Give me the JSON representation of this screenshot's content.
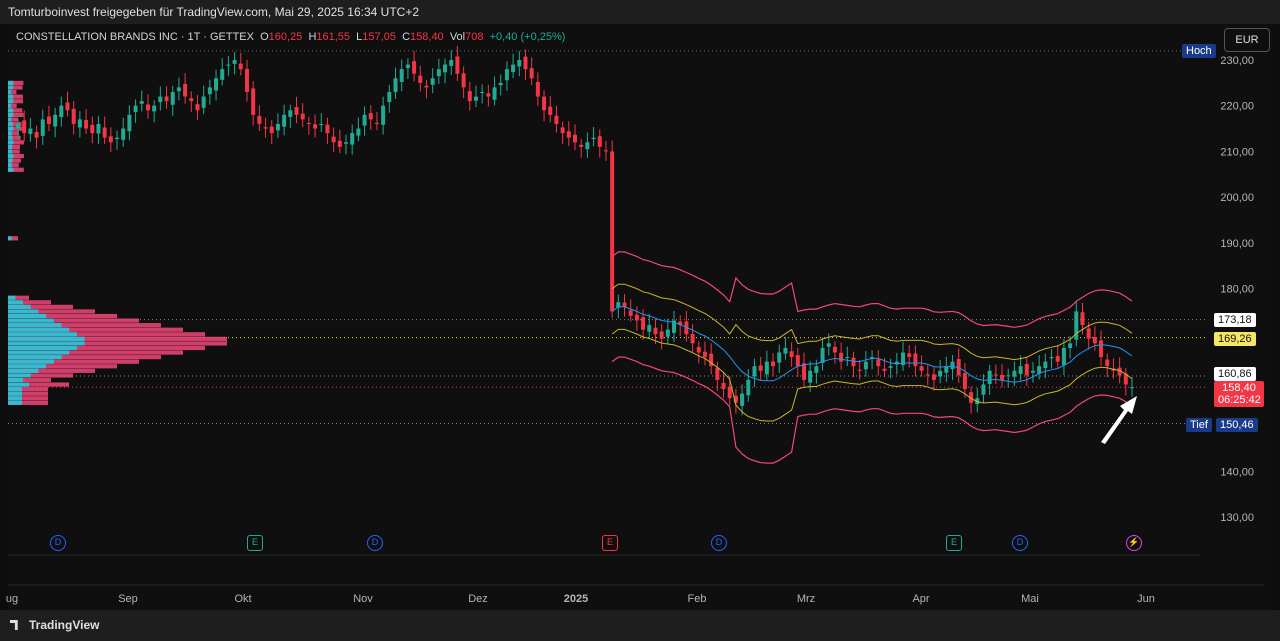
{
  "header": {
    "title": "Tomturboinvest freigegeben für TradingView.com, Mai 29, 2025 16:34 UTC+2"
  },
  "legend": {
    "symbol": "CONSTELLATION BRANDS INC · 1T · GETTEX",
    "o_label": "O",
    "o": "160,25",
    "h_label": "H",
    "h": "161,55",
    "l_label": "L",
    "l": "157,05",
    "c_label": "C",
    "c": "158,40",
    "vol_label": "Vol",
    "vol": "708",
    "change": "+0,40 (+0,25%)"
  },
  "currency_button": "EUR",
  "price_tags": {
    "hoch_label": "Hoch",
    "tief_label": "Tief",
    "tief_value": "150,46",
    "level_173": "173,18",
    "level_169": "169,26",
    "level_160": "160,86",
    "last_price": "158,40",
    "countdown": "06:25:42"
  },
  "events": [
    "D",
    "E",
    "D",
    "E",
    "D",
    "E",
    "D",
    "⚡"
  ],
  "footer": {
    "brand": "TradingView"
  },
  "colors": {
    "up": "#22ab94",
    "down": "#f23645",
    "band": "#f2467a",
    "inner_band": "#c9b62c",
    "mid_line": "#2196f3",
    "profile_cyan": "#26c6da",
    "profile_pink": "#f2467a"
  },
  "chart_data": {
    "type": "candlestick",
    "title": "",
    "x_ticks": [
      "ug",
      "Sep",
      "Okt",
      "Nov",
      "Dez",
      "2025",
      "Feb",
      "Mrz",
      "Apr",
      "Mai",
      "Jun"
    ],
    "y_ticks": [
      "230,00",
      "220,00",
      "210,00",
      "200,00",
      "190,00",
      "180,00",
      "170,00",
      "160,00",
      "150,00",
      "140,00",
      "130,00"
    ],
    "ylim": [
      124,
      233
    ],
    "horizontal_levels": [
      232.0,
      173.18,
      169.26,
      160.86,
      150.46
    ],
    "last": 158.4,
    "closes": [
      216,
      214,
      215,
      213,
      217,
      216,
      218,
      220,
      219,
      216,
      217,
      215,
      214,
      216,
      213,
      212,
      213,
      215,
      218,
      220,
      221,
      219,
      220,
      222,
      221,
      223,
      224,
      222,
      221,
      219,
      222,
      224,
      226,
      228,
      229,
      230,
      228,
      223,
      218,
      216,
      215,
      214,
      216,
      218,
      219,
      218,
      217,
      216,
      215,
      216,
      214,
      212,
      211,
      212,
      214,
      215,
      218,
      217,
      216,
      220,
      223,
      226,
      228,
      229,
      227,
      225,
      224,
      226,
      228,
      229,
      230,
      227,
      224,
      221,
      222,
      223,
      222,
      224,
      225,
      228,
      229,
      230,
      228,
      226,
      222,
      219,
      218,
      216,
      214,
      213,
      212,
      211,
      212,
      213,
      211,
      210,
      175,
      177,
      176,
      174,
      173,
      171,
      172,
      170,
      169,
      171,
      173,
      172,
      170,
      168,
      166,
      165,
      163,
      160,
      158,
      156,
      155,
      157,
      160,
      163,
      162,
      164,
      163,
      166,
      167,
      165,
      163,
      160,
      162,
      163,
      167,
      168,
      166,
      164,
      165,
      163,
      162,
      164,
      165,
      163,
      162,
      163,
      164,
      166,
      165,
      163,
      162,
      161,
      160,
      162,
      163,
      164,
      161,
      158,
      155,
      156,
      159,
      162,
      161,
      160,
      161,
      162,
      163,
      161,
      162,
      163,
      164,
      165,
      164,
      167,
      168,
      175,
      172,
      169,
      168,
      165,
      163,
      162,
      161,
      159,
      158.4
    ]
  }
}
